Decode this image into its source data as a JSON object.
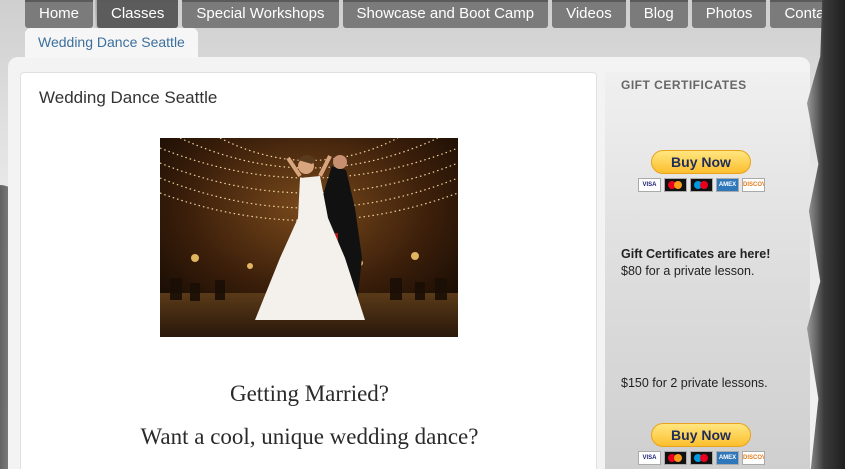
{
  "nav": {
    "items": [
      {
        "name": "nav-home",
        "label": "Home"
      },
      {
        "name": "nav-classes",
        "label": "Classes"
      },
      {
        "name": "nav-special-workshops",
        "label": "Special Workshops"
      },
      {
        "name": "nav-showcase-boot-camp",
        "label": "Showcase and Boot Camp"
      },
      {
        "name": "nav-videos",
        "label": "Videos"
      },
      {
        "name": "nav-blog",
        "label": "Blog"
      },
      {
        "name": "nav-photos",
        "label": "Photos"
      },
      {
        "name": "nav-contact",
        "label": "Contact"
      }
    ],
    "subnav": "Wedding Dance Seattle"
  },
  "main": {
    "title": "Wedding Dance Seattle",
    "line1": "Getting Married?",
    "line2": "Want a cool, unique wedding dance?"
  },
  "sidebar": {
    "heading": "GIFT CERTIFICATES",
    "buy_label": "Buy Now",
    "cards": [
      "VISA",
      "MC",
      "Maestro",
      "AMEX",
      "DISCOVER"
    ],
    "gift_here": "Gift Certificates are here!",
    "price1": "$80 for a private lesson.",
    "price2": "$150 for 2 private lessons."
  },
  "colors": {
    "nav_bg": "#7b7b7b",
    "link": "#3d6f9e",
    "paypal_yellow": "#fcbf2e"
  }
}
